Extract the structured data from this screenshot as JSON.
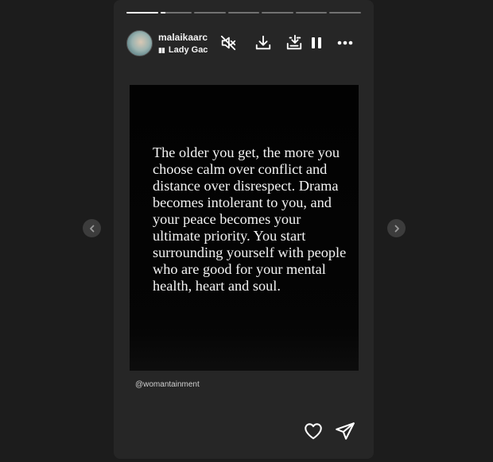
{
  "story": {
    "segments": [
      1,
      0.15,
      0,
      0,
      0,
      0,
      0
    ],
    "username": "malaikaarc",
    "music_label": "Lady Gac",
    "quote": "The older you get, the more you choose calm over conflict and distance over disrespect. Drama becomes intolerant to you, and your peace becomes your ultimate priority. You start surrounding yourself with people who are good for your mental health, heart and soul.",
    "credit": "@womantainment"
  },
  "icons": {
    "mute": "speaker-muted-icon",
    "download": "download-icon",
    "download_all": "download-all-icon",
    "pause": "pause-icon",
    "more": "more-options-icon",
    "like": "heart-icon",
    "share": "send-icon",
    "prev": "chevron-left-icon",
    "next": "chevron-right-icon"
  },
  "colors": {
    "background": "#1c1c1c",
    "story": "#262626",
    "post": "#020202"
  }
}
